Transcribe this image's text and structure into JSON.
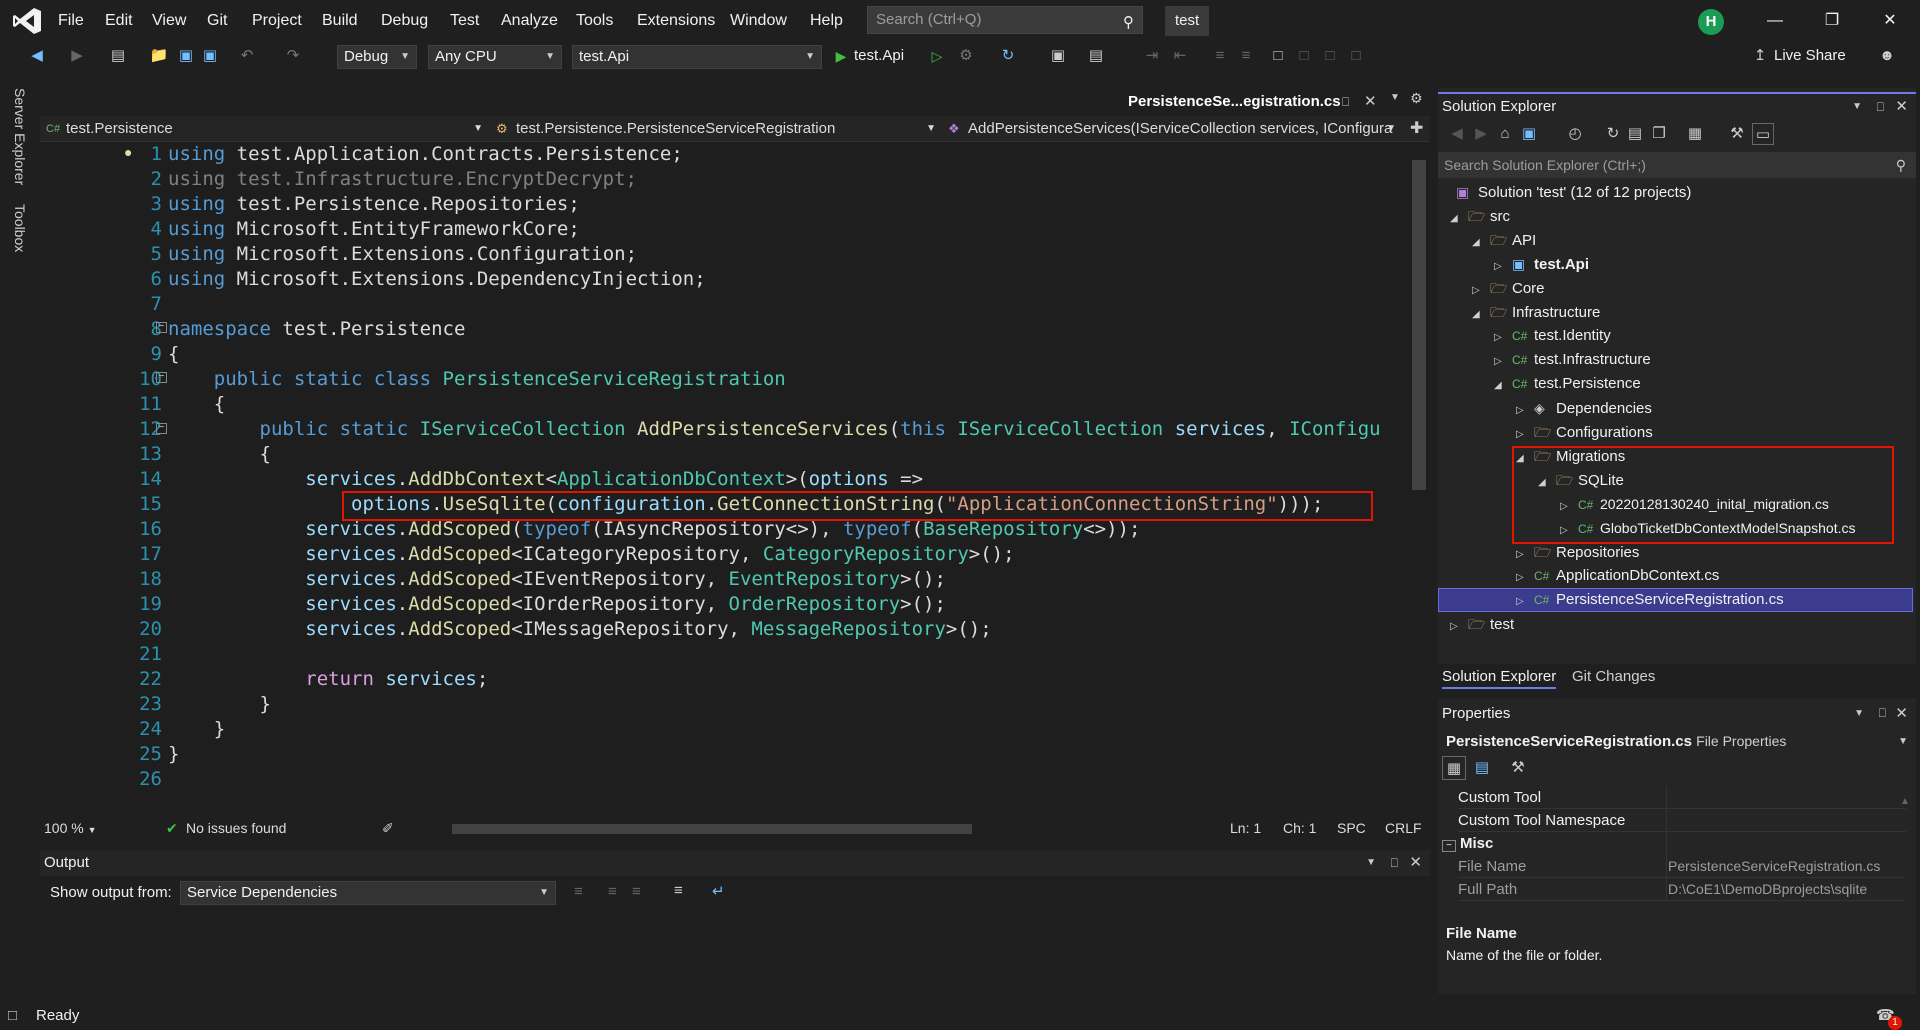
{
  "menu": [
    "File",
    "Edit",
    "View",
    "Git",
    "Project",
    "Build",
    "Debug",
    "Test",
    "Analyze",
    "Tools",
    "Extensions",
    "Window",
    "Help"
  ],
  "search": {
    "placeholder": "Search (Ctrl+Q)"
  },
  "solution_badge": "test",
  "avatar_initial": "H",
  "toolbar": {
    "config": "Debug",
    "platform": "Any CPU",
    "startup": "test.Api",
    "run_label": "test.Api",
    "live_share": "Live Share"
  },
  "side_labels": {
    "server_explorer": "Server Explorer",
    "toolbox": "Toolbox"
  },
  "editor": {
    "active_tab": "PersistenceSe...egistration.cs",
    "nav_project": "test.Persistence",
    "nav_class": "test.Persistence.PersistenceServiceRegistration",
    "nav_member": "AddPersistenceServices(IServiceCollection services, IConfigura",
    "line_numbers": [
      "1",
      "2",
      "3",
      "4",
      "5",
      "6",
      "7",
      "8",
      "9",
      "10",
      "11",
      "12",
      "13",
      "14",
      "15",
      "16",
      "17",
      "18",
      "19",
      "20",
      "21",
      "22",
      "23",
      "24",
      "25",
      "26"
    ],
    "code": {
      "l1": [
        "using",
        " test.Application.Contracts.Persistence;"
      ],
      "l2": [
        "using test.Infrastructure.EncryptDecrypt;"
      ],
      "l3": [
        "using",
        " test.Persistence.Repositories;"
      ],
      "l4": [
        "using",
        " Microsoft.EntityFrameworkCore;"
      ],
      "l5": [
        "using",
        " Microsoft.Extensions.Configuration;"
      ],
      "l6": [
        "using",
        " Microsoft.Extensions.DependencyInjection;"
      ],
      "l8": [
        "namespace",
        " test.Persistence"
      ],
      "l9": [
        "{"
      ],
      "l10": [
        "    ",
        "public static class ",
        "PersistenceServiceRegistration"
      ],
      "l11": [
        "    {"
      ],
      "l12": [
        "        ",
        "public static ",
        "IServiceCollection ",
        "AddPersistenceServices",
        "(",
        "this ",
        "IServiceCollection ",
        "services",
        ", ",
        "IConfigu"
      ],
      "l13": [
        "        {"
      ],
      "l14": [
        "            ",
        "services",
        ".",
        "AddDbContext",
        "<",
        "ApplicationDbContext",
        ">(",
        "options",
        " =>"
      ],
      "l15": [
        "                ",
        "options",
        ".",
        "UseSqlite",
        "(",
        "configuration",
        ".",
        "GetConnectionString",
        "(",
        "\"ApplicationConnectionString\"",
        ")));"
      ],
      "l16": [
        "            ",
        "services",
        ".",
        "AddScoped",
        "(",
        "typeof",
        "(IAsyncRepository<>), ",
        "typeof",
        "(",
        "BaseRepository",
        "<>));"
      ],
      "l17": [
        "            ",
        "services",
        ".",
        "AddScoped",
        "<ICategoryRepository, ",
        "CategoryRepository",
        ">();"
      ],
      "l18": [
        "            ",
        "services",
        ".",
        "AddScoped",
        "<IEventRepository, ",
        "EventRepository",
        ">();"
      ],
      "l19": [
        "            ",
        "services",
        ".",
        "AddScoped",
        "<IOrderRepository, ",
        "OrderRepository",
        ">();"
      ],
      "l20": [
        "            ",
        "services",
        ".",
        "AddScoped",
        "<IMessageRepository, ",
        "MessageRepository",
        ">();"
      ],
      "l22": [
        "            ",
        "return ",
        "services",
        ";"
      ],
      "l23": [
        "        }"
      ],
      "l24": [
        "    }"
      ],
      "l25": [
        "}"
      ]
    },
    "status": {
      "zoom": "100 %",
      "issues": "No issues found",
      "ln": "Ln: 1",
      "ch": "Ch: 1",
      "spc": "SPC",
      "crlf": "CRLF"
    }
  },
  "output": {
    "title": "Output",
    "show_from_label": "Show output from:",
    "source": "Service Dependencies"
  },
  "statusbar": {
    "ready": "Ready",
    "notifications": "1"
  },
  "solution_explorer": {
    "title": "Solution Explorer",
    "search_placeholder": "Search Solution Explorer (Ctrl+;)",
    "tree": [
      {
        "label": "Solution 'test' (12 of 12 projects)"
      },
      {
        "label": "src"
      },
      {
        "label": "API"
      },
      {
        "label": "test.Api"
      },
      {
        "label": "Core"
      },
      {
        "label": "Infrastructure"
      },
      {
        "label": "test.Identity"
      },
      {
        "label": "test.Infrastructure"
      },
      {
        "label": "test.Persistence"
      },
      {
        "label": "Dependencies"
      },
      {
        "label": "Configurations"
      },
      {
        "label": "Migrations"
      },
      {
        "label": "SQLite"
      },
      {
        "label": "20220128130240_inital_migration.cs"
      },
      {
        "label": "GloboTicketDbContextModelSnapshot.cs"
      },
      {
        "label": "Repositories"
      },
      {
        "label": "ApplicationDbContext.cs"
      },
      {
        "label": "PersistenceServiceRegistration.cs"
      },
      {
        "label": "test"
      }
    ],
    "tabs": [
      "Solution Explorer",
      "Git Changes"
    ]
  },
  "properties": {
    "title": "Properties",
    "subject": "PersistenceServiceRegistration.cs",
    "subject_kind": "File Properties",
    "rows": [
      {
        "name": "Custom Tool",
        "value": ""
      },
      {
        "name": "Custom Tool Namespace",
        "value": ""
      }
    ],
    "category": "Misc",
    "misc_rows": [
      {
        "name": "File Name",
        "value": "PersistenceServiceRegistration.cs"
      },
      {
        "name": "Full Path",
        "value": "D:\\CoE1\\DemoDBprojects\\sqlite"
      }
    ],
    "desc_title": "File Name",
    "desc_text": "Name of the file or folder."
  }
}
